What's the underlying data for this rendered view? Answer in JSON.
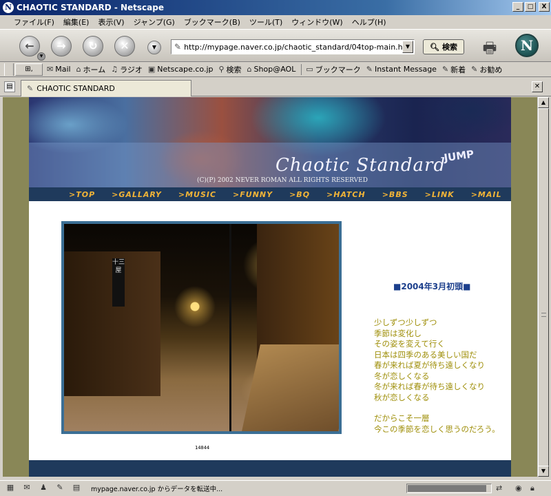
{
  "window": {
    "title": "CHAOTIC STANDARD - Netscape",
    "min_label": "_",
    "max_label": "□",
    "close_label": "X"
  },
  "menu": [
    "ファイル(F)",
    "編集(E)",
    "表示(V)",
    "ジャンプ(G)",
    "ブックマーク(B)",
    "ツール(T)",
    "ウィンドウ(W)",
    "ヘルプ(H)"
  ],
  "nav": {
    "url": "http://mypage.naver.co.jp/chaotic_standard/04top-main.htm",
    "search_label": "検索"
  },
  "personal_toolbar": {
    "items": [
      "Mail",
      "ホーム",
      "ラジオ",
      "Netscape.co.jp",
      "検索",
      "Shop@AOL",
      "ブックマーク",
      "Instant Message",
      "新着",
      "お勧め"
    ],
    "icons": [
      "mail-icon",
      "home-icon",
      "radio-icon",
      "my-netscape-icon",
      "search-icon",
      "shop-icon",
      "bookmarks-icon",
      "instant-message-icon",
      "new-icon",
      "recommend-icon"
    ]
  },
  "tab": {
    "title": "CHAOTIC STANDARD"
  },
  "site": {
    "logo": "Chaotic Standard",
    "jump_badge": "JUMP",
    "copyright": "(C)(P) 2002 NEVER ROMAN ALL RIGHTS RESERVED",
    "nav_links": [
      ">TOP",
      ">GALLARY",
      ">MUSIC",
      ">FUNNY",
      ">BQ",
      ">HATCH",
      ">BBS",
      ">LINK",
      ">MAIL"
    ],
    "photo_sign": "十三屋",
    "counter": "14844",
    "heading": "■2004年3月初頭■",
    "poem_lines": [
      "少しずつ少しずつ",
      "季節は変化し",
      "その姿を変えて行く",
      "日本は四季のある美しい国だ",
      "春が来れば夏が待ち遠しくなり",
      "冬が恋しくなる",
      "冬が来れば春が待ち遠しくなり",
      "秋が恋しくなる"
    ],
    "poem_tail": [
      "だからこそ一層",
      "今この季節を恋しく思うのだろう。"
    ],
    "colors": {
      "nav_bg": "#1f3a5c",
      "nav_text": "#f2b437",
      "poem_text": "#9f8f0a",
      "heading_text": "#1c3f8c",
      "page_bg": "#898757"
    }
  },
  "status": {
    "text": "mypage.naver.co.jp からデータを転送中...",
    "progress_fraction": 0.95
  }
}
